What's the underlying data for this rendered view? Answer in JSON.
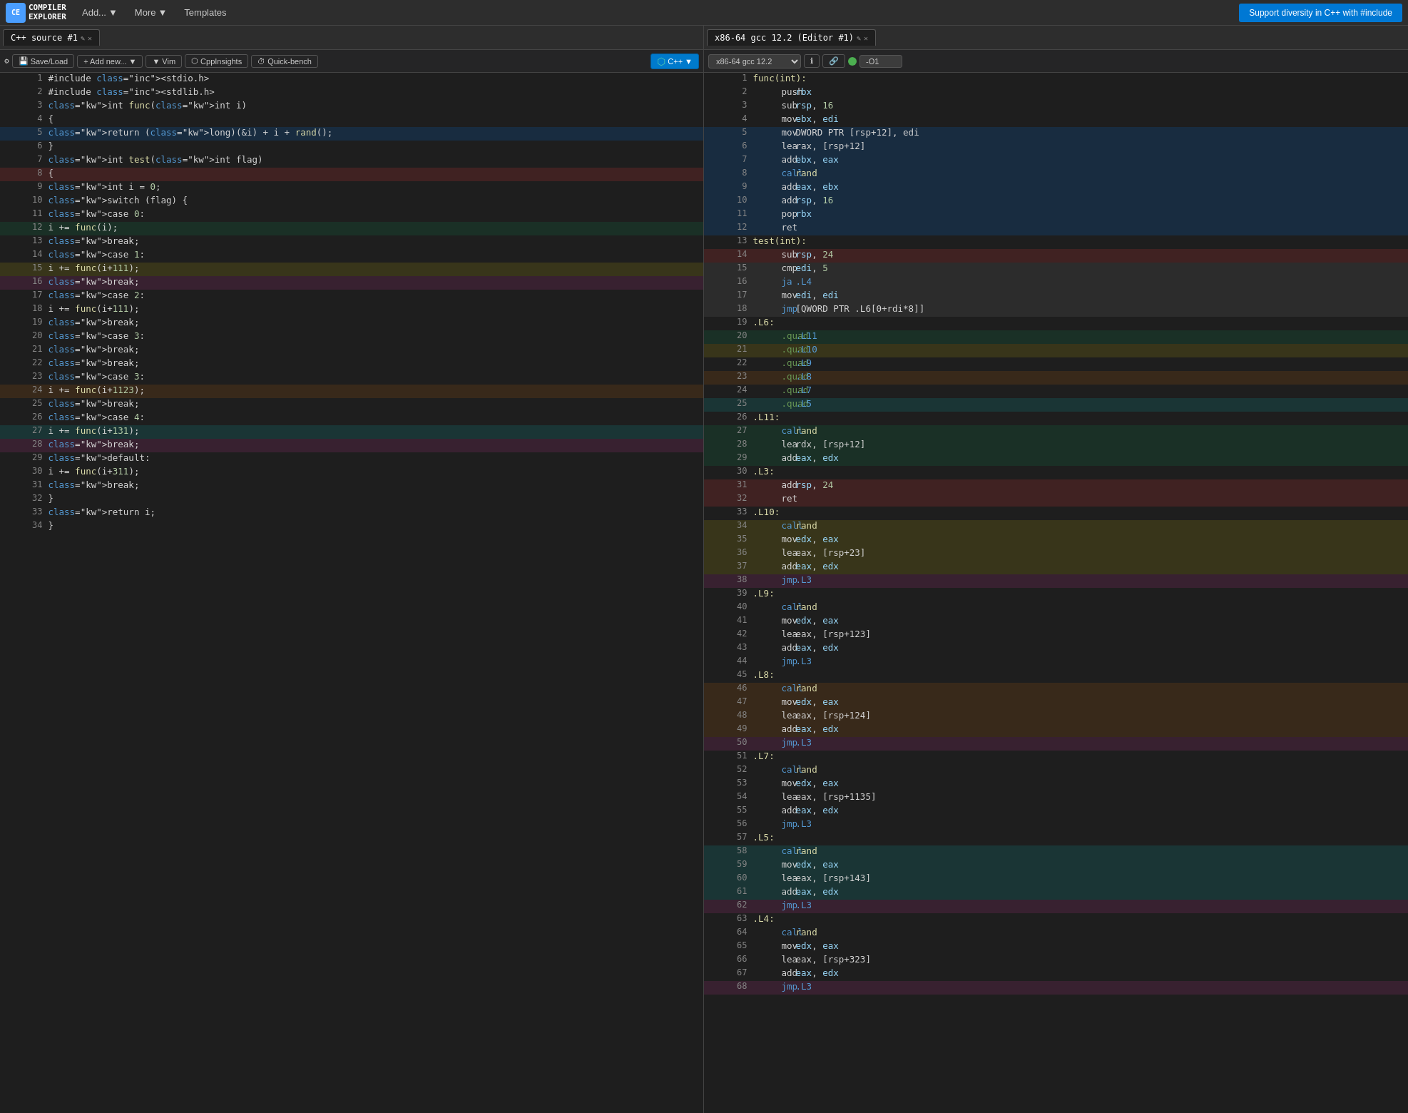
{
  "nav": {
    "logo_text": "COMPILER\nEXPLORER",
    "add_label": "Add...",
    "more_label": "More",
    "templates_label": "Templates",
    "cta_label": "Support diversity in C++ with #include"
  },
  "left_pane": {
    "tab_label": "C++ source #1",
    "toolbar": {
      "save_load": "Save/Load",
      "add_new": "+ Add new...",
      "vim": "▼ Vim",
      "cppinsights": "CppInsights",
      "quick_bench": "Quick-bench",
      "lang_label": "C++"
    },
    "lines": [
      {
        "n": 1,
        "code": "#include <stdio.h>",
        "hl": ""
      },
      {
        "n": 2,
        "code": "#include <stdlib.h>",
        "hl": ""
      },
      {
        "n": 3,
        "code": "int func(int i)",
        "hl": ""
      },
      {
        "n": 4,
        "code": "{",
        "hl": ""
      },
      {
        "n": 5,
        "code": "    return (long)(&i) + i + rand();",
        "hl": "hl-blue"
      },
      {
        "n": 6,
        "code": "}",
        "hl": ""
      },
      {
        "n": 7,
        "code": "int test(int flag)",
        "hl": ""
      },
      {
        "n": 8,
        "code": "{",
        "hl": "hl-red"
      },
      {
        "n": 9,
        "code": "    int i = 0;",
        "hl": ""
      },
      {
        "n": 10,
        "code": "    switch (flag) {",
        "hl": ""
      },
      {
        "n": 11,
        "code": "    case 0:",
        "hl": ""
      },
      {
        "n": 12,
        "code": "        i += func(i);",
        "hl": "hl-green"
      },
      {
        "n": 13,
        "code": "        break;",
        "hl": ""
      },
      {
        "n": 14,
        "code": "    case 1:",
        "hl": ""
      },
      {
        "n": 15,
        "code": "        i += func(i+111);",
        "hl": "hl-yellow"
      },
      {
        "n": 16,
        "code": "        break;",
        "hl": "hl-pink"
      },
      {
        "n": 17,
        "code": "    case 2:",
        "hl": ""
      },
      {
        "n": 18,
        "code": "        i += func(i+111);",
        "hl": ""
      },
      {
        "n": 19,
        "code": "        break;",
        "hl": ""
      },
      {
        "n": 20,
        "code": "    case 3:",
        "hl": ""
      },
      {
        "n": 21,
        "code": "        break;",
        "hl": ""
      },
      {
        "n": 22,
        "code": "        break;",
        "hl": ""
      },
      {
        "n": 23,
        "code": "    case 3:",
        "hl": ""
      },
      {
        "n": 24,
        "code": "        i += func(i+1123);",
        "hl": "hl-orange"
      },
      {
        "n": 25,
        "code": "        break;",
        "hl": ""
      },
      {
        "n": 26,
        "code": "    case 4:",
        "hl": ""
      },
      {
        "n": 27,
        "code": "        i += func(i+131);",
        "hl": "hl-teal"
      },
      {
        "n": 28,
        "code": "        break;",
        "hl": "hl-pink"
      },
      {
        "n": 29,
        "code": "    default:",
        "hl": ""
      },
      {
        "n": 30,
        "code": "        i += func(i+311);",
        "hl": ""
      },
      {
        "n": 31,
        "code": "        break;",
        "hl": ""
      },
      {
        "n": 32,
        "code": "    }",
        "hl": ""
      },
      {
        "n": 33,
        "code": "    return i;",
        "hl": ""
      },
      {
        "n": 34,
        "code": "}",
        "hl": ""
      }
    ]
  },
  "right_pane": {
    "tab_label": "x86-64 gcc 12.2 (Editor #1)",
    "compiler_label": "x86-64 gcc 12.2",
    "opt_label": "-O1",
    "lines": [
      {
        "n": 1,
        "label": "func(int):",
        "inst": "",
        "op1": "",
        "op2": "",
        "hl": ""
      },
      {
        "n": 2,
        "label": "",
        "inst": "push",
        "op1": "rbx",
        "op2": "",
        "hl": ""
      },
      {
        "n": 3,
        "label": "",
        "inst": "sub",
        "op1": "rsp, 16",
        "op2": "",
        "hl": ""
      },
      {
        "n": 4,
        "label": "",
        "inst": "mov",
        "op1": "ebx, edi",
        "op2": "",
        "hl": ""
      },
      {
        "n": 5,
        "label": "",
        "inst": "mov",
        "op1": "DWORD PTR [rsp+12], edi",
        "op2": "",
        "hl": "hl-blue"
      },
      {
        "n": 6,
        "label": "",
        "inst": "lea",
        "op1": "rax, [rsp+12]",
        "op2": "",
        "hl": "hl-blue"
      },
      {
        "n": 7,
        "label": "",
        "inst": "add",
        "op1": "ebx, eax",
        "op2": "",
        "hl": "hl-blue"
      },
      {
        "n": 8,
        "label": "",
        "inst": "call",
        "op1": "rand",
        "op2": "",
        "hl": "hl-blue"
      },
      {
        "n": 9,
        "label": "",
        "inst": "add",
        "op1": "eax, ebx",
        "op2": "",
        "hl": "hl-blue"
      },
      {
        "n": 10,
        "label": "",
        "inst": "add",
        "op1": "rsp, 16",
        "op2": "",
        "hl": "hl-blue"
      },
      {
        "n": 11,
        "label": "",
        "inst": "pop",
        "op1": "rbx",
        "op2": "",
        "hl": "hl-blue"
      },
      {
        "n": 12,
        "label": "",
        "inst": "ret",
        "op1": "",
        "op2": "",
        "hl": "hl-blue"
      },
      {
        "n": 13,
        "label": "test(int):",
        "inst": "",
        "op1": "",
        "op2": "",
        "hl": ""
      },
      {
        "n": 14,
        "label": "",
        "inst": "sub",
        "op1": "rsp, 24",
        "op2": "",
        "hl": "hl-red"
      },
      {
        "n": 15,
        "label": "",
        "inst": "cmp",
        "op1": "edi, 5",
        "op2": "",
        "hl": "hl-grey"
      },
      {
        "n": 16,
        "label": "",
        "inst": "ja",
        "op1": ".L4",
        "op2": "",
        "hl": "hl-grey"
      },
      {
        "n": 17,
        "label": "",
        "inst": "mov",
        "op1": "edi, edi",
        "op2": "",
        "hl": "hl-grey"
      },
      {
        "n": 18,
        "label": "",
        "inst": "jmp",
        "op1": "[QWORD PTR .L6[0+rdi*8]]",
        "op2": "",
        "hl": "hl-grey"
      },
      {
        "n": 19,
        "label": ".L6:",
        "inst": "",
        "op1": "",
        "op2": "",
        "hl": ""
      },
      {
        "n": 20,
        "label": "",
        "inst": ".quad",
        "op1": ".L11",
        "op2": "",
        "hl": "hl-green"
      },
      {
        "n": 21,
        "label": "",
        "inst": ".quad",
        "op1": ".L10",
        "op2": "",
        "hl": "hl-yellow"
      },
      {
        "n": 22,
        "label": "",
        "inst": ".quad",
        "op1": ".L9",
        "op2": "",
        "hl": ""
      },
      {
        "n": 23,
        "label": "",
        "inst": ".quad",
        "op1": ".L8",
        "op2": "",
        "hl": "hl-orange"
      },
      {
        "n": 24,
        "label": "",
        "inst": ".quad",
        "op1": ".L7",
        "op2": "",
        "hl": ""
      },
      {
        "n": 25,
        "label": "",
        "inst": ".quad",
        "op1": ".L5",
        "op2": "",
        "hl": "hl-teal"
      },
      {
        "n": 26,
        "label": ".L11:",
        "inst": "",
        "op1": "",
        "op2": "",
        "hl": ""
      },
      {
        "n": 27,
        "label": "",
        "inst": "call",
        "op1": "rand",
        "op2": "",
        "hl": "hl-green"
      },
      {
        "n": 28,
        "label": "",
        "inst": "lea",
        "op1": "rdx, [rsp+12]",
        "op2": "",
        "hl": "hl-green"
      },
      {
        "n": 29,
        "label": "",
        "inst": "add",
        "op1": "eax, edx",
        "op2": "",
        "hl": "hl-green"
      },
      {
        "n": 30,
        "label": ".L3:",
        "inst": "",
        "op1": "",
        "op2": "",
        "hl": ""
      },
      {
        "n": 31,
        "label": "",
        "inst": "add",
        "op1": "rsp, 24",
        "op2": "",
        "hl": "hl-red"
      },
      {
        "n": 32,
        "label": "",
        "inst": "ret",
        "op1": "",
        "op2": "",
        "hl": "hl-red"
      },
      {
        "n": 33,
        "label": ".L10:",
        "inst": "",
        "op1": "",
        "op2": "",
        "hl": ""
      },
      {
        "n": 34,
        "label": "",
        "inst": "call",
        "op1": "rand",
        "op2": "",
        "hl": "hl-yellow"
      },
      {
        "n": 35,
        "label": "",
        "inst": "mov",
        "op1": "edx, eax",
        "op2": "",
        "hl": "hl-yellow"
      },
      {
        "n": 36,
        "label": "",
        "inst": "lea",
        "op1": "eax, [rsp+23]",
        "op2": "",
        "hl": "hl-yellow"
      },
      {
        "n": 37,
        "label": "",
        "inst": "add",
        "op1": "eax, edx",
        "op2": "",
        "hl": "hl-yellow"
      },
      {
        "n": 38,
        "label": "",
        "inst": "jmp",
        "op1": ".L3",
        "op2": "",
        "hl": "hl-pink"
      },
      {
        "n": 39,
        "label": ".L9:",
        "inst": "",
        "op1": "",
        "op2": "",
        "hl": ""
      },
      {
        "n": 40,
        "label": "",
        "inst": "call",
        "op1": "rand",
        "op2": "",
        "hl": ""
      },
      {
        "n": 41,
        "label": "",
        "inst": "mov",
        "op1": "edx, eax",
        "op2": "",
        "hl": ""
      },
      {
        "n": 42,
        "label": "",
        "inst": "lea",
        "op1": "eax, [rsp+123]",
        "op2": "",
        "hl": ""
      },
      {
        "n": 43,
        "label": "",
        "inst": "add",
        "op1": "eax, edx",
        "op2": "",
        "hl": ""
      },
      {
        "n": 44,
        "label": "",
        "inst": "jmp",
        "op1": ".L3",
        "op2": "",
        "hl": ""
      },
      {
        "n": 45,
        "label": ".L8:",
        "inst": "",
        "op1": "",
        "op2": "",
        "hl": ""
      },
      {
        "n": 46,
        "label": "",
        "inst": "call",
        "op1": "rand",
        "op2": "",
        "hl": "hl-orange"
      },
      {
        "n": 47,
        "label": "",
        "inst": "mov",
        "op1": "edx, eax",
        "op2": "",
        "hl": "hl-orange"
      },
      {
        "n": 48,
        "label": "",
        "inst": "lea",
        "op1": "eax, [rsp+124]",
        "op2": "",
        "hl": "hl-orange"
      },
      {
        "n": 49,
        "label": "",
        "inst": "add",
        "op1": "eax, edx",
        "op2": "",
        "hl": "hl-orange"
      },
      {
        "n": 50,
        "label": "",
        "inst": "jmp",
        "op1": ".L3",
        "op2": "",
        "hl": "hl-pink"
      },
      {
        "n": 51,
        "label": ".L7:",
        "inst": "",
        "op1": "",
        "op2": "",
        "hl": ""
      },
      {
        "n": 52,
        "label": "",
        "inst": "call",
        "op1": "rand",
        "op2": "",
        "hl": ""
      },
      {
        "n": 53,
        "label": "",
        "inst": "mov",
        "op1": "edx, eax",
        "op2": "",
        "hl": ""
      },
      {
        "n": 54,
        "label": "",
        "inst": "lea",
        "op1": "eax, [rsp+1135]",
        "op2": "",
        "hl": ""
      },
      {
        "n": 55,
        "label": "",
        "inst": "add",
        "op1": "eax, edx",
        "op2": "",
        "hl": ""
      },
      {
        "n": 56,
        "label": "",
        "inst": "jmp",
        "op1": ".L3",
        "op2": "",
        "hl": ""
      },
      {
        "n": 57,
        "label": ".L5:",
        "inst": "",
        "op1": "",
        "op2": "",
        "hl": ""
      },
      {
        "n": 58,
        "label": "",
        "inst": "call",
        "op1": "rand",
        "op2": "",
        "hl": "hl-teal"
      },
      {
        "n": 59,
        "label": "",
        "inst": "mov",
        "op1": "edx, eax",
        "op2": "",
        "hl": "hl-teal"
      },
      {
        "n": 60,
        "label": "",
        "inst": "lea",
        "op1": "eax, [rsp+143]",
        "op2": "",
        "hl": "hl-teal"
      },
      {
        "n": 61,
        "label": "",
        "inst": "add",
        "op1": "eax, edx",
        "op2": "",
        "hl": "hl-teal"
      },
      {
        "n": 62,
        "label": "",
        "inst": "jmp",
        "op1": ".L3",
        "op2": "",
        "hl": "hl-pink"
      },
      {
        "n": 63,
        "label": ".L4:",
        "inst": "",
        "op1": "",
        "op2": "",
        "hl": ""
      },
      {
        "n": 64,
        "label": "",
        "inst": "call",
        "op1": "rand",
        "op2": "",
        "hl": ""
      },
      {
        "n": 65,
        "label": "",
        "inst": "mov",
        "op1": "edx, eax",
        "op2": "",
        "hl": ""
      },
      {
        "n": 66,
        "label": "",
        "inst": "lea",
        "op1": "eax, [rsp+323]",
        "op2": "",
        "hl": ""
      },
      {
        "n": 67,
        "label": "",
        "inst": "add",
        "op1": "eax, edx",
        "op2": "",
        "hl": ""
      },
      {
        "n": 68,
        "label": "",
        "inst": "jmp",
        "op1": ".L3",
        "op2": "",
        "hl": "hl-pink"
      }
    ]
  }
}
